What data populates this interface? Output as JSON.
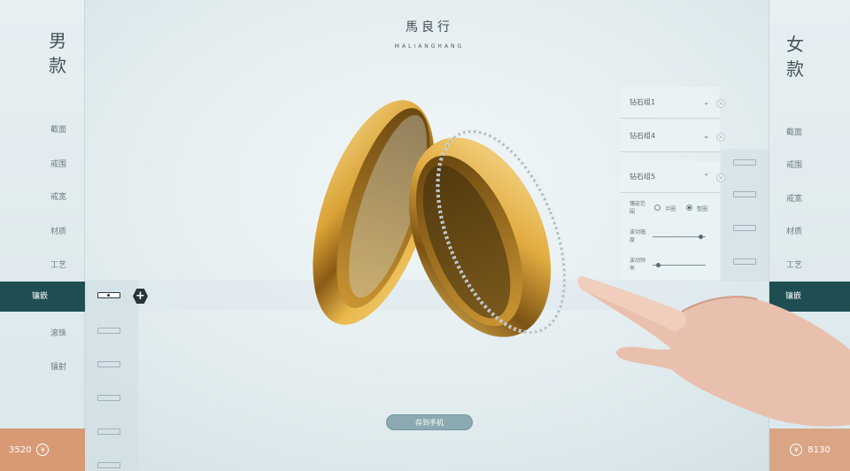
{
  "brand": {
    "name_cn": "馬良行",
    "name_en": "MALIANGHANG"
  },
  "left_panel": {
    "title": "男款",
    "menu": [
      "截面",
      "戒围",
      "戒宽",
      "材质",
      "工艺",
      "镶嵌",
      "滚珠",
      "镭射"
    ],
    "active_index": 5,
    "price": "3520",
    "currency_symbol": "¥"
  },
  "right_panel": {
    "title": "女款",
    "menu": [
      "截面",
      "戒围",
      "戒宽",
      "材质",
      "工艺",
      "镶嵌"
    ],
    "active_index": 5,
    "price": "8130",
    "currency_symbol": "¥"
  },
  "diamond_groups": [
    {
      "label": "钻石组1",
      "expanded": false
    },
    {
      "label": "钻石组4",
      "expanded": false
    },
    {
      "label": "钻石组5",
      "expanded": true
    }
  ],
  "group5_settings": {
    "range_label": "镶嵌范围",
    "options": [
      "半圈",
      "整圈"
    ],
    "selected_option": "整圈",
    "amplitude_label": "波动幅度",
    "amplitude_value": 0.9,
    "frequency_label": "波动频率",
    "frequency_value": 0.1
  },
  "save_button": "存到手机",
  "colors": {
    "active_teal": "#1f4e52",
    "price_bg": "#d79a75",
    "gold": "#e0a93a"
  }
}
